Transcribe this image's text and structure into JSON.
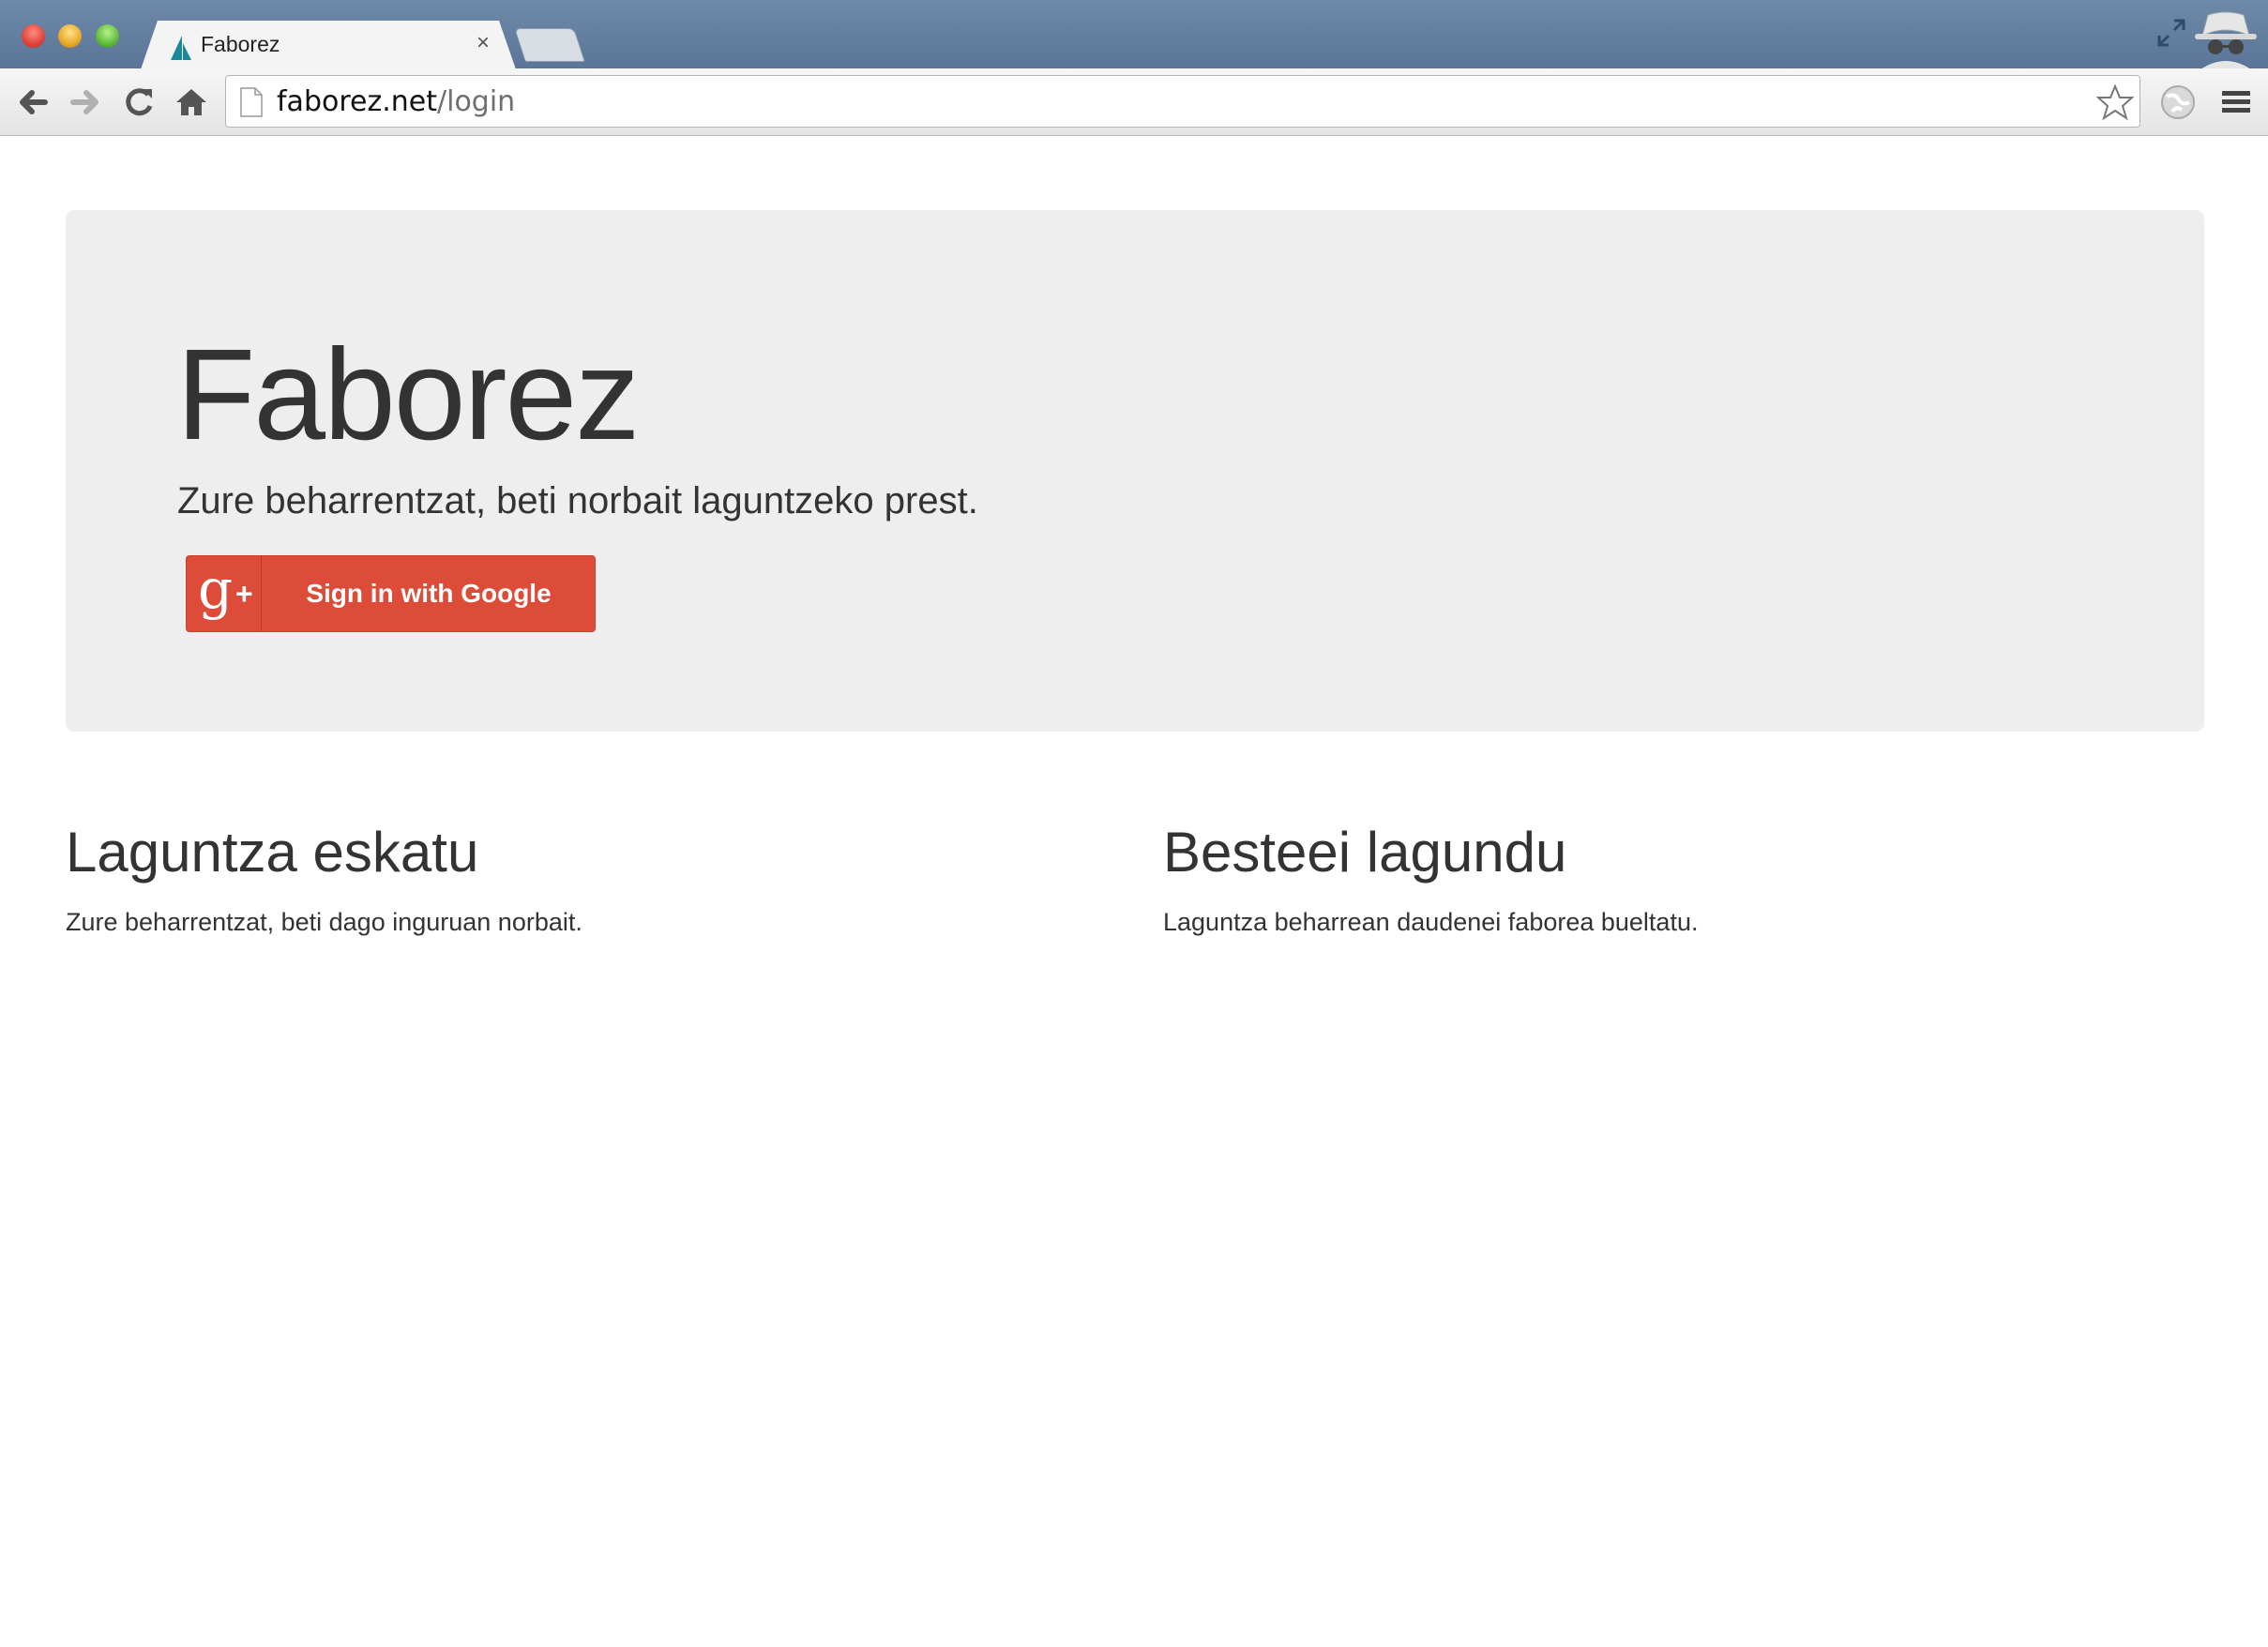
{
  "browser": {
    "tab": {
      "title": "Faborez",
      "close": "×"
    },
    "omnibox": {
      "host": "faborez.net",
      "path": "/login"
    }
  },
  "colors": {
    "accent": "#dd4b39",
    "jumbotron_bg": "#eeeeee",
    "text": "#333333",
    "favicon": "#1a8a9a"
  },
  "hero": {
    "title": "Faborez",
    "lead": "Zure beharrentzat, beti norbait laguntzeko prest.",
    "signin": {
      "icon_glyph": "g",
      "icon_plus": "+",
      "label": "Sign in with Google"
    }
  },
  "features": [
    {
      "heading": "Laguntza eskatu",
      "text": "Zure beharrentzat, beti dago inguruan norbait."
    },
    {
      "heading": "Besteei lagundu",
      "text": "Laguntza beharrean daudenei faborea bueltatu."
    }
  ]
}
